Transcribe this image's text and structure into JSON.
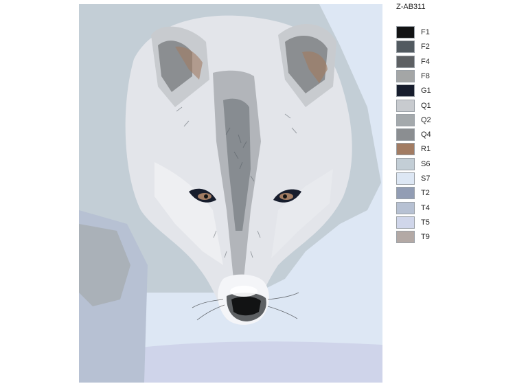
{
  "product_code": "Z-AB311",
  "palette": [
    {
      "code": "F1",
      "color": "#121314"
    },
    {
      "code": "F2",
      "color": "#525a60"
    },
    {
      "code": "F4",
      "color": "#5d6063"
    },
    {
      "code": "F8",
      "color": "#a4a6a6"
    },
    {
      "code": "G1",
      "color": "#171d2d"
    },
    {
      "code": "Q1",
      "color": "#c8cbcf"
    },
    {
      "code": "Q2",
      "color": "#a4a9ac"
    },
    {
      "code": "Q4",
      "color": "#8b8e91"
    },
    {
      "code": "R1",
      "color": "#a27c63"
    },
    {
      "code": "S6",
      "color": "#c3ced6"
    },
    {
      "code": "S7",
      "color": "#dde7f4"
    },
    {
      "code": "T2",
      "color": "#929db4"
    },
    {
      "code": "T4",
      "color": "#b7c1d3"
    },
    {
      "code": "T5",
      "color": "#d0d6ea"
    },
    {
      "code": "T9",
      "color": "#b3a9a5"
    }
  ]
}
